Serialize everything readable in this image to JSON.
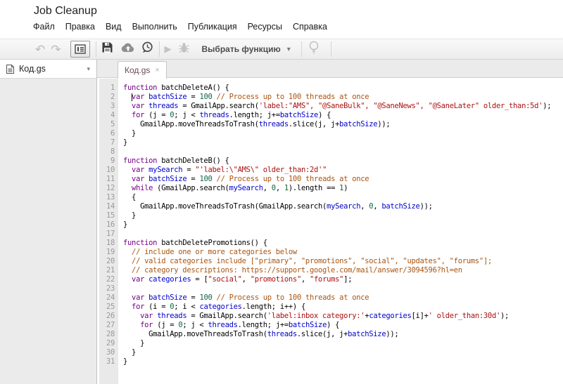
{
  "header": {
    "title": "Job Cleanup",
    "menus": [
      {
        "id": "file",
        "label": "Файл"
      },
      {
        "id": "edit",
        "label": "Правка"
      },
      {
        "id": "view",
        "label": "Вид"
      },
      {
        "id": "run",
        "label": "Выполнить"
      },
      {
        "id": "publish",
        "label": "Публикация"
      },
      {
        "id": "resources",
        "label": "Ресурсы"
      },
      {
        "id": "help",
        "label": "Справка"
      }
    ]
  },
  "toolbar": {
    "undo_icon": "↶",
    "redo_icon": "↷",
    "run_icon": "▶",
    "dropdown_caret": "▾",
    "select_function_label": "Выбрать функцию"
  },
  "sidebar": {
    "file_name": "Код.gs",
    "caret_icon": "▾"
  },
  "editor": {
    "tab_label": "Код.gs",
    "tab_close": "×",
    "cursor": {
      "line": 2,
      "col": 2
    },
    "syntax_colors": {
      "k": "#770088",
      "v": "#0000cc",
      "n": "#116644",
      "s": "#aa1111",
      "c": "#aa5511",
      "p": "#000000"
    },
    "lines": [
      [
        [
          "k",
          "function"
        ],
        [
          "p",
          " batchDeleteA() {"
        ]
      ],
      [
        [
          "p",
          "  "
        ],
        [
          "k",
          "var"
        ],
        [
          "p",
          " "
        ],
        [
          "v",
          "batchSize"
        ],
        [
          "p",
          " = "
        ],
        [
          "n",
          "100"
        ],
        [
          "p",
          " "
        ],
        [
          "c",
          "// Process up to 100 threads at once"
        ]
      ],
      [
        [
          "p",
          "  "
        ],
        [
          "k",
          "var"
        ],
        [
          "p",
          " "
        ],
        [
          "v",
          "threads"
        ],
        [
          "p",
          " = GmailApp.search("
        ],
        [
          "s",
          "'label:\"AMS\", \"@SaneBulk\", \"@SaneNews\", \"@SaneLater\" older_than:5d'"
        ],
        [
          "p",
          ");"
        ]
      ],
      [
        [
          "p",
          "  "
        ],
        [
          "k",
          "for"
        ],
        [
          "p",
          " (j = "
        ],
        [
          "n",
          "0"
        ],
        [
          "p",
          "; j < "
        ],
        [
          "v",
          "threads"
        ],
        [
          "p",
          ".length; j+="
        ],
        [
          "v",
          "batchSize"
        ],
        [
          "p",
          ") {"
        ]
      ],
      [
        [
          "p",
          "    GmailApp.moveThreadsToTrash("
        ],
        [
          "v",
          "threads"
        ],
        [
          "p",
          ".slice(j, j+"
        ],
        [
          "v",
          "batchSize"
        ],
        [
          "p",
          "));"
        ]
      ],
      [
        [
          "p",
          "  }"
        ]
      ],
      [
        [
          "p",
          "}"
        ]
      ],
      [],
      [
        [
          "k",
          "function"
        ],
        [
          "p",
          " batchDeleteB() {"
        ]
      ],
      [
        [
          "p",
          "  "
        ],
        [
          "k",
          "var"
        ],
        [
          "p",
          " "
        ],
        [
          "v",
          "mySearch"
        ],
        [
          "p",
          " = "
        ],
        [
          "s",
          "\"'label:\\\"AMS\\\" older_than:2d'\""
        ]
      ],
      [
        [
          "p",
          "  "
        ],
        [
          "k",
          "var"
        ],
        [
          "p",
          " "
        ],
        [
          "v",
          "batchSize"
        ],
        [
          "p",
          " = "
        ],
        [
          "n",
          "100"
        ],
        [
          "p",
          " "
        ],
        [
          "c",
          "// Process up to 100 threads at once"
        ]
      ],
      [
        [
          "p",
          "  "
        ],
        [
          "k",
          "while"
        ],
        [
          "p",
          " (GmailApp.search("
        ],
        [
          "v",
          "mySearch"
        ],
        [
          "p",
          ", "
        ],
        [
          "n",
          "0"
        ],
        [
          "p",
          ", "
        ],
        [
          "n",
          "1"
        ],
        [
          "p",
          ").length == "
        ],
        [
          "n",
          "1"
        ],
        [
          "p",
          ")"
        ]
      ],
      [
        [
          "p",
          "  {"
        ]
      ],
      [
        [
          "p",
          "    GmailApp.moveThreadsToTrash(GmailApp.search("
        ],
        [
          "v",
          "mySearch"
        ],
        [
          "p",
          ", "
        ],
        [
          "n",
          "0"
        ],
        [
          "p",
          ", "
        ],
        [
          "v",
          "batchSize"
        ],
        [
          "p",
          "));"
        ]
      ],
      [
        [
          "p",
          "  }"
        ]
      ],
      [
        [
          "p",
          "}"
        ]
      ],
      [],
      [
        [
          "k",
          "function"
        ],
        [
          "p",
          " batchDeletePromotions() {"
        ]
      ],
      [
        [
          "p",
          "  "
        ],
        [
          "c",
          "// include one or more categories below"
        ]
      ],
      [
        [
          "p",
          "  "
        ],
        [
          "c",
          "// valid categories include [\"primary\", \"promotions\", \"social\", \"updates\", \"forums\"];"
        ]
      ],
      [
        [
          "p",
          "  "
        ],
        [
          "c",
          "// category descriptions: https://support.google.com/mail/answer/3094596?hl=en"
        ]
      ],
      [
        [
          "p",
          "  "
        ],
        [
          "k",
          "var"
        ],
        [
          "p",
          " "
        ],
        [
          "v",
          "categories"
        ],
        [
          "p",
          " = ["
        ],
        [
          "s",
          "\"social\""
        ],
        [
          "p",
          ", "
        ],
        [
          "s",
          "\"promotions\""
        ],
        [
          "p",
          ", "
        ],
        [
          "s",
          "\"forums\""
        ],
        [
          "p",
          "];"
        ]
      ],
      [],
      [
        [
          "p",
          "  "
        ],
        [
          "k",
          "var"
        ],
        [
          "p",
          " "
        ],
        [
          "v",
          "batchSize"
        ],
        [
          "p",
          " = "
        ],
        [
          "n",
          "100"
        ],
        [
          "p",
          " "
        ],
        [
          "c",
          "// Process up to 100 threads at once"
        ]
      ],
      [
        [
          "p",
          "  "
        ],
        [
          "k",
          "for"
        ],
        [
          "p",
          " (i = "
        ],
        [
          "n",
          "0"
        ],
        [
          "p",
          "; i < "
        ],
        [
          "v",
          "categories"
        ],
        [
          "p",
          ".length; i++) {"
        ]
      ],
      [
        [
          "p",
          "    "
        ],
        [
          "k",
          "var"
        ],
        [
          "p",
          " "
        ],
        [
          "v",
          "threads"
        ],
        [
          "p",
          " = GmailApp.search("
        ],
        [
          "s",
          "'label:inbox category:'"
        ],
        [
          "p",
          "+"
        ],
        [
          "v",
          "categories"
        ],
        [
          "p",
          "[i]+"
        ],
        [
          "s",
          "' older_than:30d'"
        ],
        [
          "p",
          ");"
        ]
      ],
      [
        [
          "p",
          "    "
        ],
        [
          "k",
          "for"
        ],
        [
          "p",
          " (j = "
        ],
        [
          "n",
          "0"
        ],
        [
          "p",
          "; j < "
        ],
        [
          "v",
          "threads"
        ],
        [
          "p",
          ".length; j+="
        ],
        [
          "v",
          "batchSize"
        ],
        [
          "p",
          ") {"
        ]
      ],
      [
        [
          "p",
          "      GmailApp.moveThreadsToTrash("
        ],
        [
          "v",
          "threads"
        ],
        [
          "p",
          ".slice(j, j+"
        ],
        [
          "v",
          "batchSize"
        ],
        [
          "p",
          "));"
        ]
      ],
      [
        [
          "p",
          "    }"
        ]
      ],
      [
        [
          "p",
          "  }"
        ]
      ],
      [
        [
          "p",
          "}"
        ]
      ]
    ]
  },
  "colors": {
    "logo_blue": "#4285f4",
    "toolbar_border": "#d2d2d2",
    "tab_label": "#6a4a57"
  }
}
